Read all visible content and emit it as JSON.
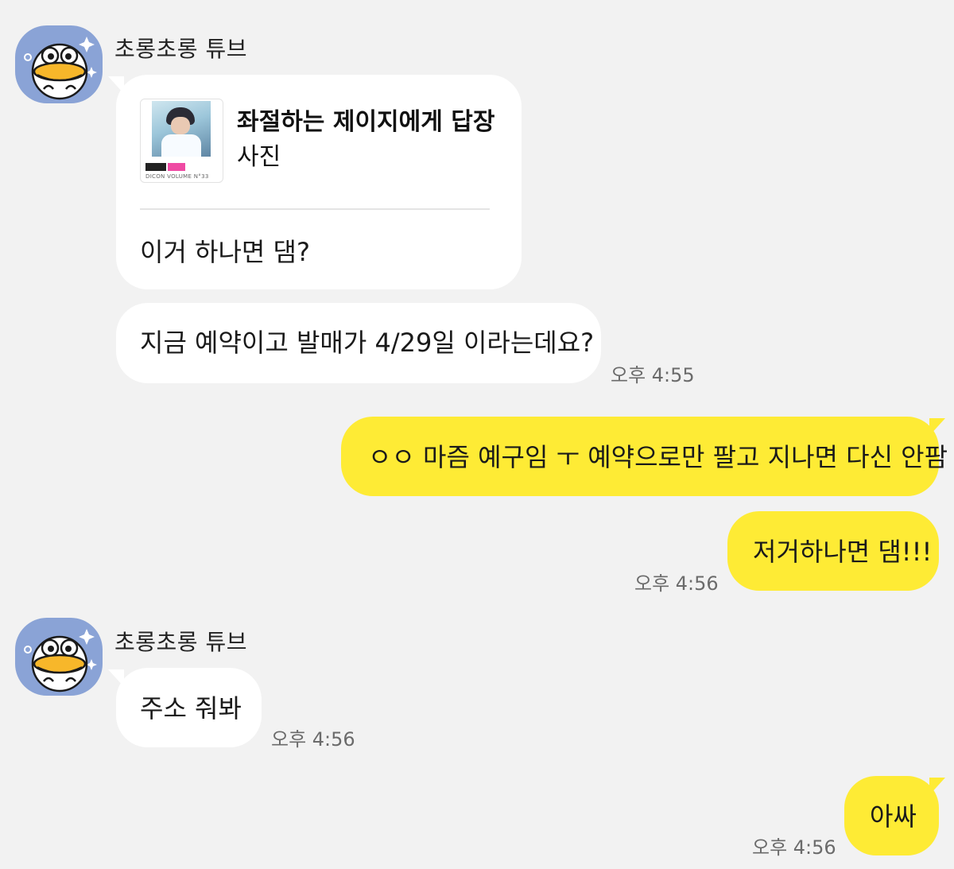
{
  "chat": {
    "sender_name": "초롱초롱 튜브",
    "messages": [
      {
        "link_title": "좌절하는 제이지에게 답장",
        "link_subtitle": "사진",
        "link_caption": "DICON VOLUME N°33",
        "text": "이거 하나면 댐?"
      },
      {
        "text": "지금 예약이고 발매가 4/29일 이라는데요?",
        "time": "오후 4:55"
      },
      {
        "text": "ㅇㅇ 마즘 예구임 ㅜ 예약으로만 팔고 지나면 다신 안팜"
      },
      {
        "text": "저거하나면 댐!!!",
        "time": "오후 4:56"
      },
      {
        "text": "주소 줘봐",
        "time": "오후 4:56"
      },
      {
        "text": "아싸",
        "time": "오후 4:56"
      }
    ]
  },
  "colors": {
    "background": "#f2f2f2",
    "incoming_bubble": "#ffffff",
    "outgoing_bubble": "#feeb35",
    "avatar_bg": "#8aa3d6"
  }
}
